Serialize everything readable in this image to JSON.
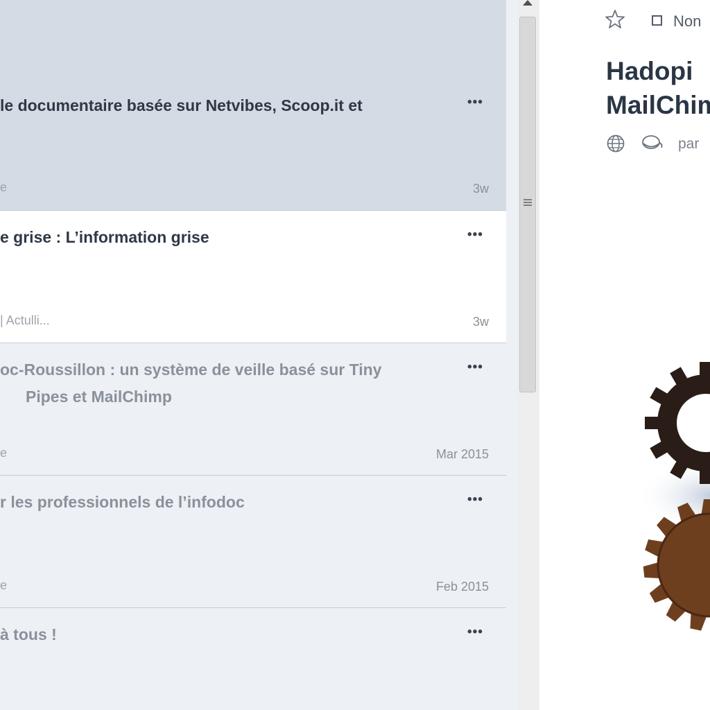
{
  "articles": [
    {
      "title_line1": "le documentaire basée sur Netvibes, Scoop.it et",
      "title_line2": "",
      "source": "e",
      "time": "3w",
      "more": "•••",
      "state": "selected"
    },
    {
      "title_line1": "e grise : L’information grise",
      "title_line2": "",
      "source": "| Actulli...",
      "time": "3w",
      "more": "•••",
      "state": "unread"
    },
    {
      "title_line1": "oc-Roussillon : un système de veille basé sur Tiny",
      "title_line2": "Pipes et MailChimp",
      "source": "e",
      "time": "Mar 2015",
      "more": "•••",
      "state": "read"
    },
    {
      "title_line1": "r les professionnels de l’infodoc",
      "title_line2": "",
      "source": "e",
      "time": "Feb 2015",
      "more": "•••",
      "state": "read"
    },
    {
      "title_line1": "à tous !",
      "title_line2": "",
      "source": "",
      "time": "",
      "more": "•••",
      "state": "read"
    }
  ],
  "reader": {
    "toolbar": {
      "star_icon": "star-icon",
      "mark_label": "Non"
    },
    "title_line1": "Hadopi",
    "title_line2": "MailChim",
    "meta": {
      "globe_icon": "globe-icon",
      "feed_icon": "feed-icon",
      "by_label": "par"
    }
  },
  "colors": {
    "selected_bg": "#d5dbe4",
    "unread_bg": "#ffffff",
    "read_bg": "#edf0f4",
    "title_dark": "#2e3847",
    "title_read": "#8a919c",
    "gear_dark": "#2a1d17",
    "gear_brown": "#6e3f1f"
  }
}
